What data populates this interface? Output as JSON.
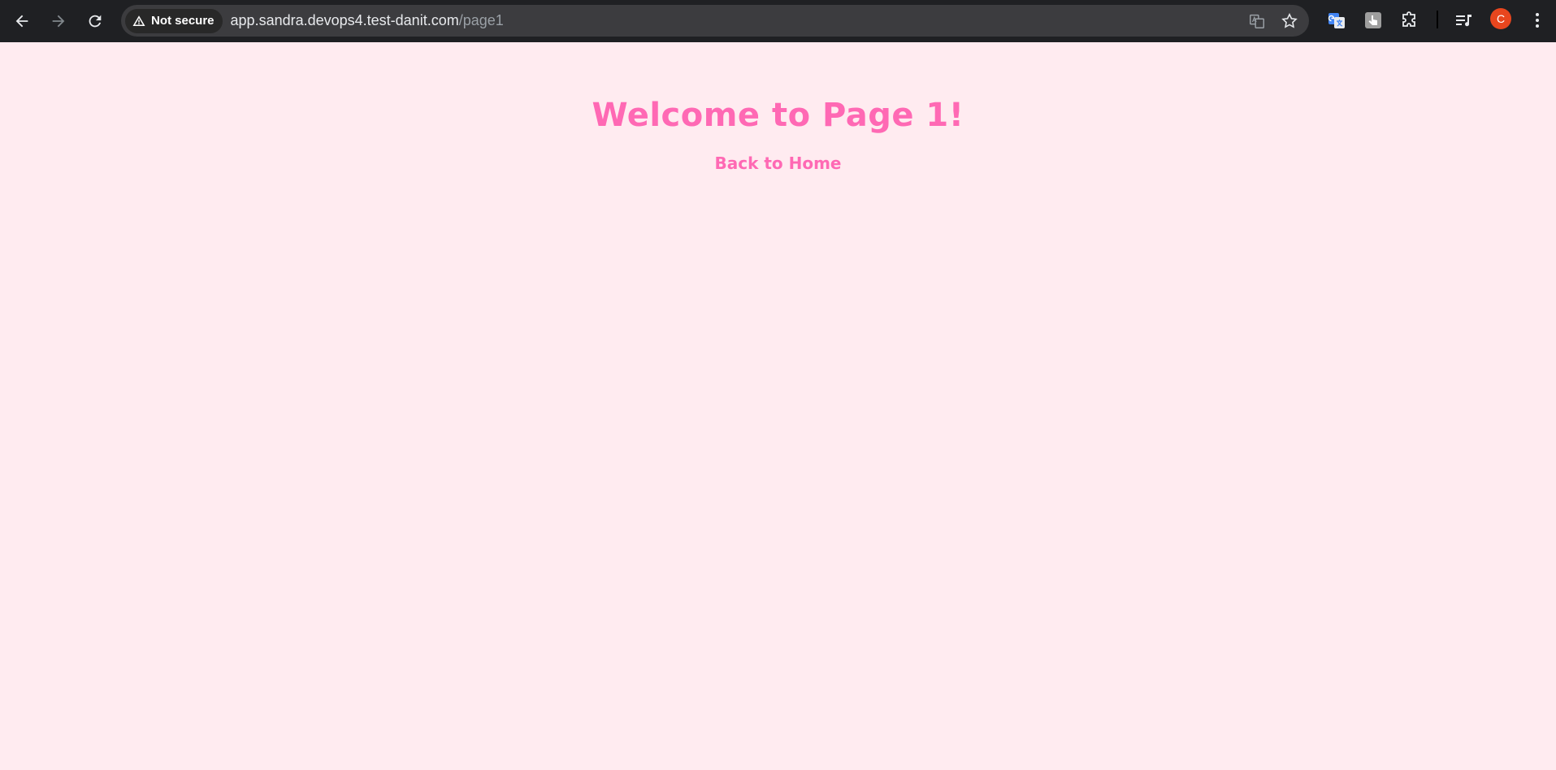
{
  "browser": {
    "security_label": "Not secure",
    "url_host": "app.sandra.devops4.test-danit.com",
    "url_path": "/page1",
    "avatar_letter": "C",
    "colors": {
      "toolbar": "#1f2023",
      "omnibox": "#3c3c3f",
      "avatar": "#e8461e"
    }
  },
  "page": {
    "heading": "Welcome to Page 1!",
    "link_label": "Back to Home",
    "colors": {
      "background": "#ffebf0",
      "accent": "#ff69b4"
    }
  }
}
